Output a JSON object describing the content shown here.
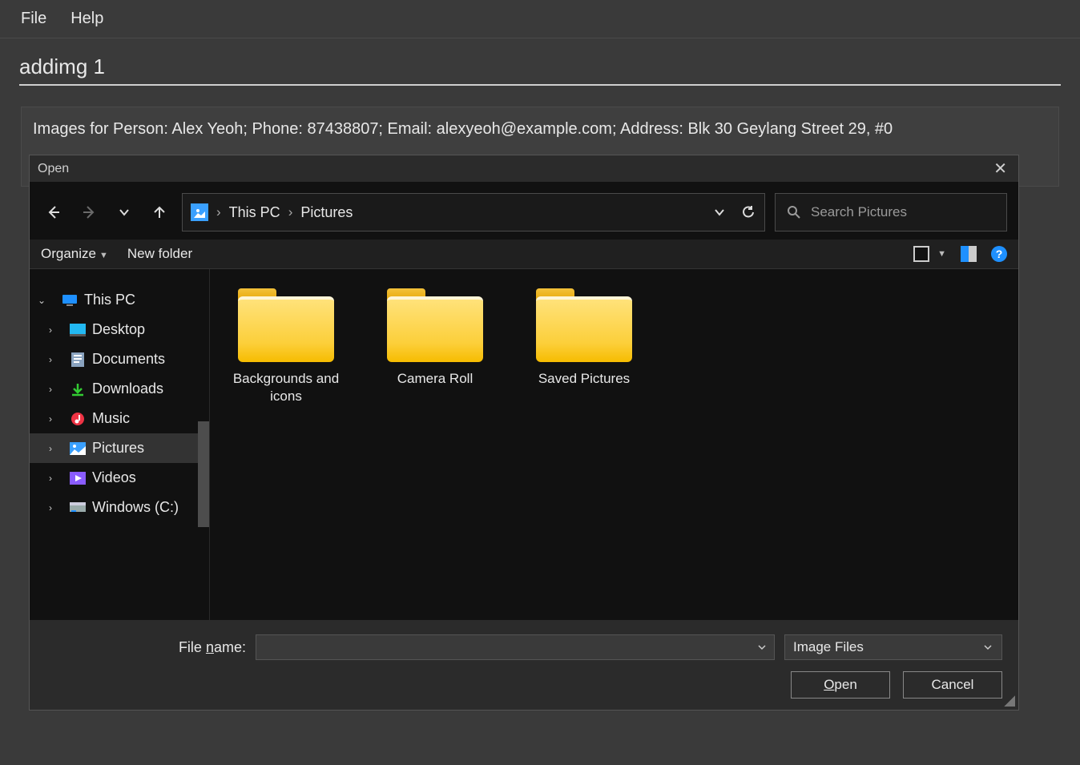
{
  "app": {
    "menu": {
      "file": "File",
      "help": "Help"
    },
    "command": "addimg 1",
    "result_text": "Images for Person: Alex Yeoh; Phone: 87438807; Email: alexyeoh@example.com; Address: Blk 30 Geylang Street 29, #0"
  },
  "dialog": {
    "title": "Open",
    "breadcrumb": {
      "root": "This PC",
      "current": "Pictures"
    },
    "search_placeholder": "Search Pictures",
    "toolbar": {
      "organize": "Organize",
      "new_folder": "New folder"
    },
    "nav": {
      "root": "This PC",
      "items": [
        "Desktop",
        "Documents",
        "Downloads",
        "Music",
        "Pictures",
        "Videos",
        "Windows (C:)"
      ]
    },
    "folders": [
      {
        "name": "Backgrounds and icons"
      },
      {
        "name": "Camera Roll"
      },
      {
        "name": "Saved Pictures"
      }
    ],
    "footer": {
      "file_name_label_pre": "File ",
      "file_name_label_u": "n",
      "file_name_label_post": "ame:",
      "file_name_value": "",
      "filter": "Image Files",
      "open": "Open",
      "open_u": "O",
      "open_post": "pen",
      "cancel": "Cancel"
    }
  }
}
